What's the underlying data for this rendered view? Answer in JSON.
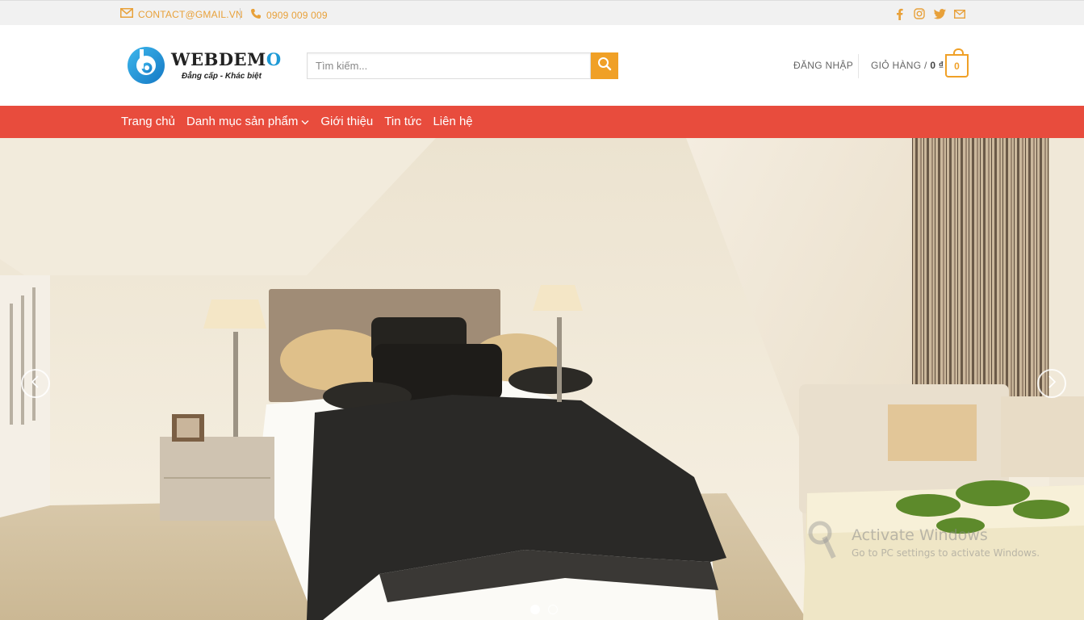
{
  "topbar": {
    "email": "CONTACT@GMAIL.VN",
    "phone": "0909 009 009",
    "social_icons": [
      "facebook-icon",
      "instagram-icon",
      "twitter-icon",
      "email-icon"
    ]
  },
  "header": {
    "logo_text_main": "WEBDEM",
    "logo_text_end": "O",
    "logo_tagline": "Đẳng cấp - Khác biệt",
    "search_placeholder": "Tìm kiếm...",
    "login_label": "ĐĂNG NHẬP",
    "cart_label": "GIỎ HÀNG /",
    "cart_total": "0 ₫",
    "cart_count": "0"
  },
  "nav": {
    "items": [
      {
        "label": "Trang chủ"
      },
      {
        "label": "Danh mục sản phẩm",
        "has_dropdown": true
      },
      {
        "label": "Giới thiệu"
      },
      {
        "label": "Tin tức"
      },
      {
        "label": "Liên hệ"
      }
    ]
  },
  "hero": {
    "slide_count": 2,
    "active_slide": 1,
    "watermark_title": "Activate Windows",
    "watermark_sub": "Go to PC settings to activate Windows."
  },
  "colors": {
    "accent_orange": "#f0a026",
    "nav_red": "#e84c3d",
    "logo_blue": "#1e9ad6"
  }
}
